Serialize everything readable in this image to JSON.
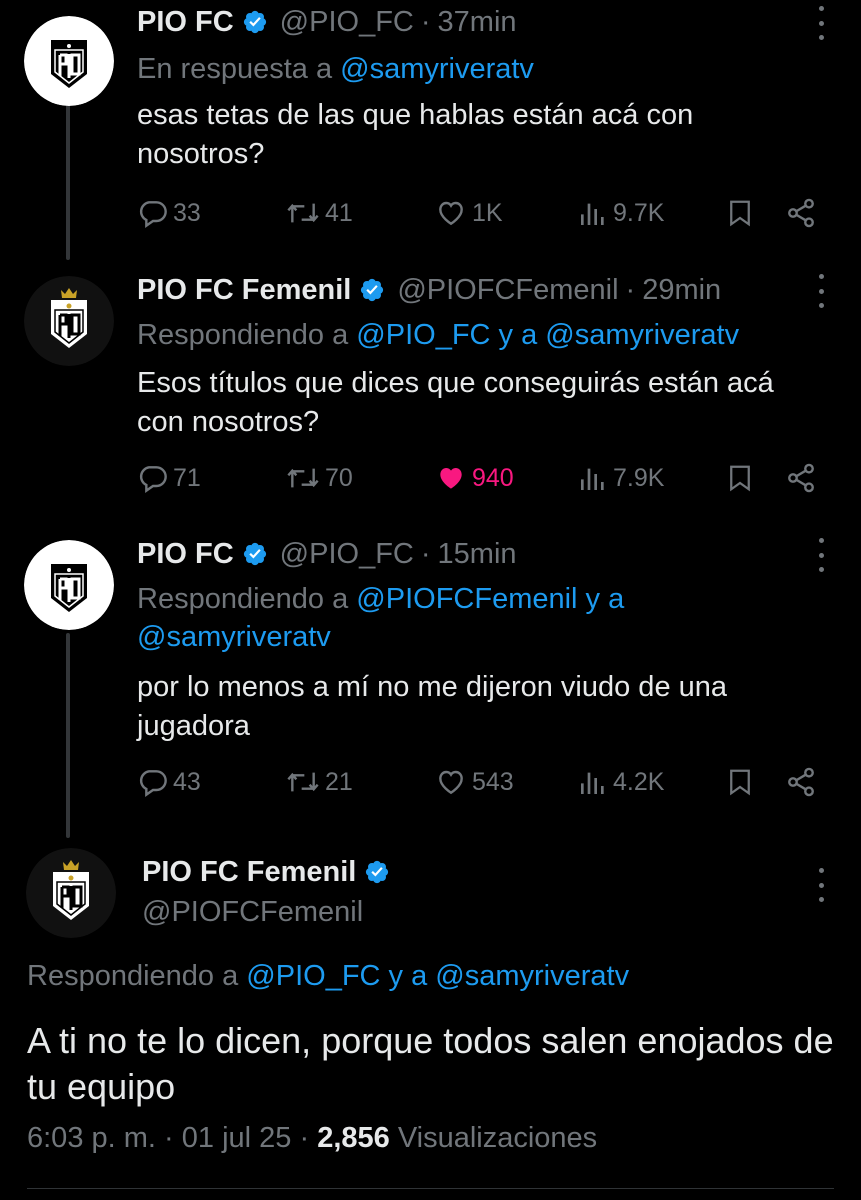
{
  "accounts": {
    "pio_fc": {
      "name": "PIO FC",
      "handle": "@PIO_FC"
    },
    "pio_fem": {
      "name": "PIO FC Femenil",
      "handle": "@PIOFCFemenil"
    }
  },
  "tweets": [
    {
      "name": "PIO FC",
      "handle": "@PIO_FC",
      "dot": "·",
      "time": "37min",
      "reply_prefix": "En respuesta a ",
      "reply_links": [
        "@samyriveratv"
      ],
      "text": "esas tetas de las que hablas están acá con nosotros?",
      "replies": "33",
      "retweets": "41",
      "likes": "1K",
      "views": "9.7K",
      "liked": false
    },
    {
      "name": "PIO FC Femenil",
      "handle": "@PIOFCFemenil",
      "dot": "·",
      "time": "29min",
      "reply_prefix": "Respondiendo a ",
      "reply_links": [
        "@PIO_FC",
        "@samyriveratv"
      ],
      "reply_joiner": " y a ",
      "text": "Esos títulos que dices que conseguirás están acá con nosotros?",
      "replies": "71",
      "retweets": "70",
      "likes": "940",
      "views": "7.9K",
      "liked": true
    },
    {
      "name": "PIO FC",
      "handle": "@PIO_FC",
      "dot": "·",
      "time": "15min",
      "reply_prefix": "Respondiendo a ",
      "reply_links": [
        "@PIOFCFemenil",
        "@samyriveratv"
      ],
      "reply_joiner": " y a",
      "text": "por lo menos a mí no me dijeron viudo de una jugadora",
      "replies": "43",
      "retweets": "21",
      "likes": "543",
      "views": "4.2K",
      "liked": false
    }
  ],
  "main_tweet": {
    "name": "PIO FC Femenil",
    "handle": "@PIOFCFemenil",
    "reply_prefix": "Respondiendo a ",
    "reply_links": [
      "@PIO_FC",
      "@samyriveratv"
    ],
    "reply_joiner": " y a ",
    "text": "A ti no te lo dicen, porque todos salen enojados de tu equipo",
    "time": "6:03 p. m.",
    "sep1": " · ",
    "date": "01 jul 25",
    "sep2": " · ",
    "views_count": "2,856",
    "views_label": " Visualizaciones"
  },
  "icons": {
    "verified": "verified-badge-icon",
    "reply": "reply-icon",
    "retweet": "retweet-icon",
    "like": "heart-icon",
    "views": "views-icon",
    "bookmark": "bookmark-icon",
    "share": "share-icon",
    "more": "more-vertical-icon"
  },
  "colors": {
    "link": "#1d9bf0",
    "verified": "#1d9bf0",
    "like_active": "#f91880",
    "muted": "#71767b",
    "background": "#000000"
  }
}
